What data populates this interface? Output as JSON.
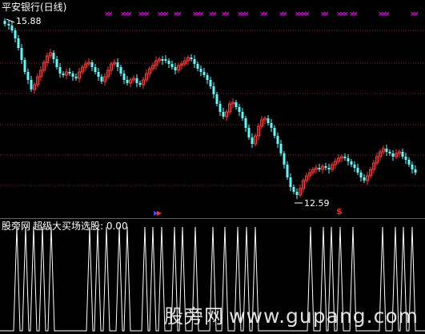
{
  "stock": {
    "title": "平安银行(日线)"
  },
  "indicator": {
    "source": "股旁网",
    "title": "超级大买场选股: 0.00"
  },
  "labels": {
    "max_price": "15.88",
    "min_price": "12.59",
    "signal_mark": "$"
  },
  "watermark": {
    "cn": "股旁网",
    "url": "www.gupang.com"
  },
  "colors": {
    "background": "#000000",
    "up_candle": "#ff3232",
    "down_candle": "#54ffff",
    "x_markers": "#ff00ff",
    "grid": "#8b1a1a",
    "indicator_line": "#ffffff"
  },
  "chart_data": [
    {
      "type": "candlestick",
      "price_high": 15.88,
      "price_low": 12.59,
      "n_bars": 141
    },
    {
      "type": "line",
      "series": [
        {
          "values_spike_positions_fraction": [
            0.04,
            0.06,
            0.08,
            0.1,
            0.12,
            0.21,
            0.23,
            0.25,
            0.28,
            0.3,
            0.34,
            0.36,
            0.38,
            0.41,
            0.43,
            0.46,
            0.5,
            0.53,
            0.56,
            0.58,
            0.6,
            0.73,
            0.76,
            0.78,
            0.8,
            0.83,
            0.9,
            0.93,
            0.95,
            0.97
          ]
        }
      ]
    }
  ]
}
